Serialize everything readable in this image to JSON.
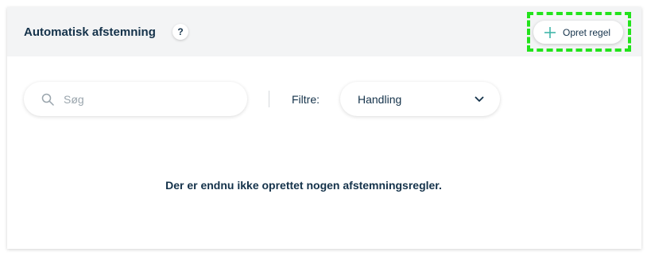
{
  "header": {
    "title": "Automatisk afstemning",
    "help_label": "?",
    "create_button_label": "Opret regel"
  },
  "toolbar": {
    "search_placeholder": "Søg",
    "search_value": "",
    "filter_label": "Filtre:",
    "filter_selected": "Handling"
  },
  "main": {
    "empty_message": "Der er endnu ikke oprettet nogen afstemningsregler."
  },
  "icons": {
    "help": "question-icon",
    "create": "plus-icon",
    "search": "search-icon",
    "dropdown": "chevron-down-icon"
  },
  "colors": {
    "text_dark": "#14324a",
    "header_bg": "#f3f4f5",
    "plus_accent": "#3fb6a8",
    "highlight": "#22e31b"
  }
}
